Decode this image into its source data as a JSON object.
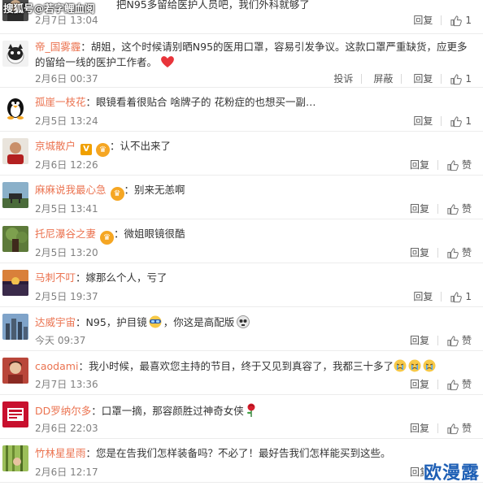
{
  "watermark_top": "搜狐号@若字鲤血阅",
  "watermark_bottom": "欧漫露",
  "comments": [
    {
      "text": "把N95多留给医护人员吧，我们外科就够了",
      "username": "",
      "time": "2月7日 13:04",
      "actions": {
        "reply": "回复"
      },
      "likes": "1"
    },
    {
      "username": "帝_国雾霾",
      "text": "胡姐，这个时候请别晒N95的医用口罩，容易引发争议。这款口罩严重缺货，应更多",
      "text2": "的留给一线的医护工作者。",
      "emoji": "heart",
      "time": "2月6日 00:37",
      "actions": {
        "report": "投诉",
        "block": "屏蔽",
        "reply": "回复"
      },
      "likes": "1"
    },
    {
      "username": "孤崖一枝花",
      "text": "眼镜看着很贴合 啥牌子的 花粉症的也想买一副…",
      "time": "2月5日 13:24",
      "actions": {
        "reply": "回复"
      },
      "likes": "1"
    },
    {
      "username": "京城散户",
      "text": "认不出来了",
      "time": "2月6日 12:26",
      "actions": {
        "reply": "回复"
      },
      "likes": "赞"
    },
    {
      "username": "麻麻说我最心急",
      "text": "别来无恙啊",
      "time": "2月5日 13:41",
      "actions": {
        "reply": "回复"
      },
      "likes": "赞"
    },
    {
      "username": "托尼瀑谷之妻",
      "text": "微姐眼镜很酷",
      "time": "2月5日 13:20",
      "actions": {
        "reply": "回复"
      },
      "likes": "赞"
    },
    {
      "username": "马刺不叮",
      "text": "嫁那么个人，亏了",
      "time": "2月5日 19:37",
      "actions": {
        "reply": "回复"
      },
      "likes": "1"
    },
    {
      "username": "达威宇宙",
      "text": "N95，护目镜",
      "text_after": "，你这是高配版",
      "time": "今天 09:37",
      "actions": {
        "reply": "回复"
      },
      "likes": "赞"
    },
    {
      "username": "caodami",
      "text": "我小时候，最喜欢您主持的节目，终于又见到真容了，我都三十多了",
      "time": "2月7日 13:36",
      "actions": {
        "reply": "回复"
      },
      "likes": "赞"
    },
    {
      "username": "DD罗纳尔多",
      "text": "口罩一摘，那容颜胜过神奇女侠",
      "time": "2月6日 22:03",
      "actions": {
        "reply": "回复"
      },
      "likes": "赞"
    },
    {
      "username": "竹林星星雨",
      "text": "您是在告我们怎样装备吗？不必了！最好告我们怎样能买到这些。",
      "time": "2月6日 12:17",
      "actions": {
        "reply": "回复"
      },
      "likes": "赞"
    }
  ]
}
